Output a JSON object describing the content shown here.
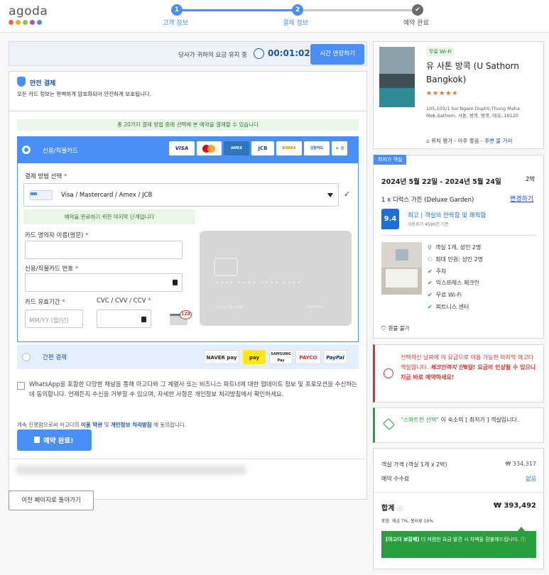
{
  "header": {
    "logo": "agoda",
    "steps": [
      {
        "num": "1",
        "label": "고객 정보"
      },
      {
        "num": "2",
        "label": "결제 정보"
      },
      {
        "num": "✔",
        "label": "예약 완료"
      }
    ]
  },
  "timer": {
    "text": "당사가 귀하의 요금 유지 중",
    "time": "00:01:02",
    "extend_button": "시간 연장하기"
  },
  "secure": {
    "title": "안전 결제",
    "desc": "모든 카드 정보는 완벽하게 암호화되어 안전하게 보호됩니다."
  },
  "payment": {
    "methods_note": "총 20가지 결제 방법 중에 선택해 본 예약을 결제할 수 있습니다",
    "card_option": "신용/직불카드",
    "brands": [
      "VISA",
      "",
      "AMEX",
      "JCB",
      "KOREA",
      "신한카드",
      "+ 9"
    ],
    "method_label": "결제 방법 선택",
    "method_value": "Visa / Mastercard / Amex / JCB",
    "final_step_note": "예약을 완료하기 위한 마지막 단계입니다",
    "name_label": "카드 명의자 이름(영문)",
    "number_label": "신용/직불카드 번호",
    "expiry_label": "카드 유효기간",
    "expiry_placeholder": "MM/YY (월/년)",
    "cvc_label": "CVC / CVV / CCV",
    "cvc_badge": "123",
    "card_preview": {
      "number": "•••• •••• •••• ••••",
      "name": "FULL NAME",
      "expiry": "**/****"
    },
    "simple_option": "간편 결제",
    "simple_brands": [
      "NAVER pay",
      "pay",
      "SAMSUNG Pay",
      "PAYCO",
      "PayPal"
    ],
    "required_mark": "*"
  },
  "consent": {
    "text": "WhatsApp을 포함한 다양한 채널을 통해 아고다와 그 계열사 또는 비즈니스 파트너에 대한 업데이트 정보 및 프로모션을 수신하는 데 동의합니다. 언제든지 수신을 거부할 수 있으며, 자세한 사항은 개인정보 처리방침에서 확인하세요."
  },
  "terms": {
    "prefix": "계속 진행함으로써 아고다의",
    "terms_link": "이용 약관",
    "and": "및",
    "privacy_link": "개인정보 처리방침",
    "suffix": "에 동의합니다."
  },
  "complete_button": "예약 완료!",
  "back_button": "이전 페이지로 돌아가기",
  "hotel": {
    "badge": "무료 Wi-Fi",
    "name": "유 사톤 방콕 (U Sathorn Bangkok)",
    "stars": "★★★★★",
    "address": "105,105/1 Soi Ngam Duphli,Thung Maha Mek,Sathorn, 사톤, 방콕, 방콕, 태국, 10120",
    "loc_prefix": "위치 평가 - 아주 좋음 -",
    "loc_link": "주변 볼 거리"
  },
  "room": {
    "tag": "최저가 객실",
    "dates": "2024년 5월 22일 - 2024년 5월 24일",
    "nights": "2박",
    "room_name": "1 x 디럭스 가든 (Deluxe Garden)",
    "change": "변경하기",
    "score": "9.4",
    "score_text": "최고 | 객실의 안락함 및 쾌적함",
    "reviews": "이용후기 4590건 기준",
    "amenities": [
      "객실 1개, 성인 2명",
      "최대 인원: 성인 2명",
      "주차",
      "익스프레스 체크인",
      "무료 Wi-Fi",
      "피트니스 센터"
    ],
    "refund": "환불 불가"
  },
  "alert": {
    "text": "선택하신 날짜에 이 요금으로 이용 가능한 마지막 아고다 객실입니다.",
    "bold_prefix": "체크인까지 단",
    "bold_num": "8",
    "bold_suffix": "일! 요금이 인상될 수 있으니 지금 바로 예약하세요!"
  },
  "smart": {
    "highlight": "\"스마트한 선택\"",
    "text": "이 숙소의 [ 최저가 ] 객실입니다."
  },
  "price": {
    "room_label": "객실 가격 (객실 1개 x 2박)",
    "room_value": "₩ 334,317",
    "fee_label": "예약 수수료",
    "fee_value": "없음",
    "total_label": "합계",
    "total_value": "₩ 393,492",
    "tax": "포함: 세금 7%, 봉사료 10%",
    "guarantee_bold": "[아고다 보장제]",
    "guarantee_text": "더 저렴한 요금 발견 시 차액을 환불해드립니다."
  },
  "colors": {
    "accent": "#4a8ff5",
    "dark_blue": "#1a4fb4",
    "green": "#2a9d3e",
    "red": "#e12d2d"
  }
}
